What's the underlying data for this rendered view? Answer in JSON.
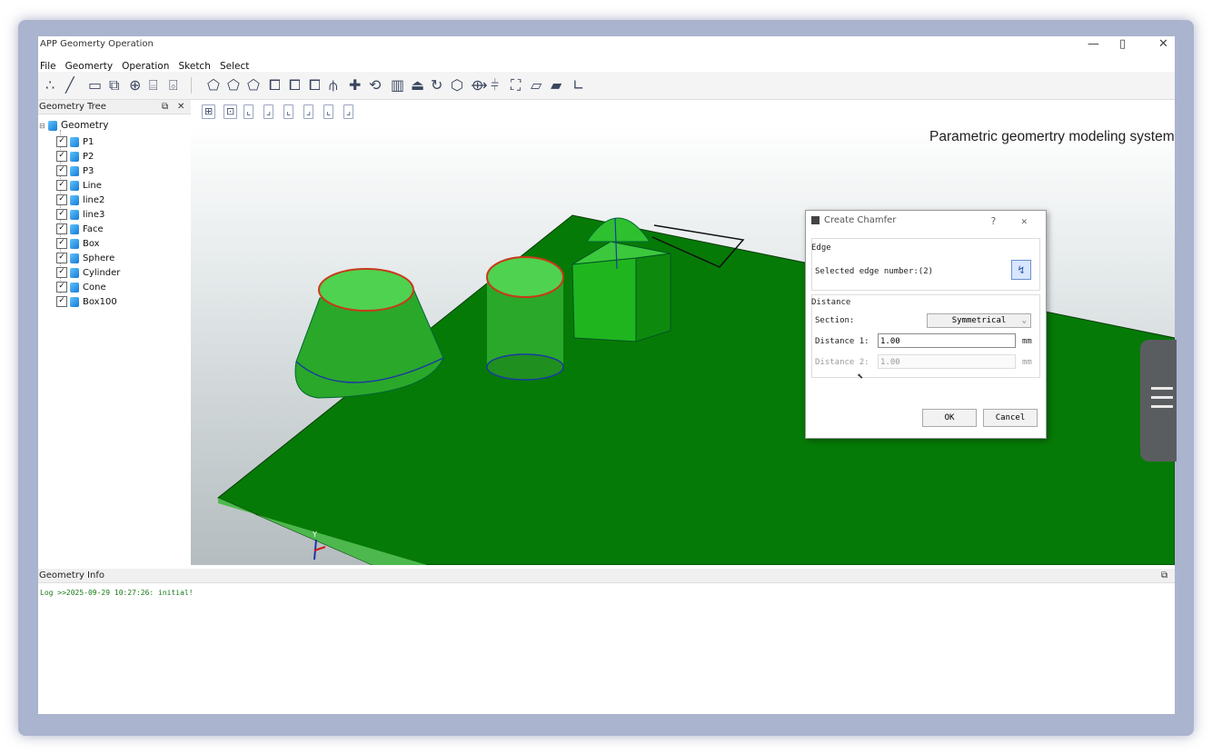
{
  "window": {
    "title": "APP Geomerty Operation",
    "minimize_glyph": "—",
    "restore_glyph": "▯",
    "close_glyph": "✕"
  },
  "menubar": {
    "items": [
      "File",
      "Geomerty",
      "Operation",
      "Sketch",
      "Select"
    ]
  },
  "sidebar": {
    "title": "Geometry Tree",
    "float_glyph": "⧉",
    "close_glyph": "✕",
    "root": "Geometry",
    "items": [
      "P1",
      "P2",
      "P3",
      "Line",
      "line2",
      "line3",
      "Face",
      "Box",
      "Sphere",
      "Cylinder",
      "Cone",
      "Box100"
    ]
  },
  "viewport": {
    "watermark": "Parametric geomertry modeling system"
  },
  "dialog": {
    "title": "Create Chamfer",
    "help_glyph": "?",
    "close_glyph": "✕",
    "edge_group": "Edge",
    "selected_edge_label": "Selected edge number:(2)",
    "distance_group": "Distance",
    "section_label": "Section:",
    "section_value": "Symmetrical",
    "distance1_label": "Distance 1:",
    "distance1_value": "1.00",
    "distance1_unit": "mm",
    "distance2_label": "Distance 2:",
    "distance2_value": "1.00",
    "distance2_unit": "mm",
    "ok_label": "OK",
    "cancel_label": "Cancel"
  },
  "info": {
    "title": "Geometry Info",
    "float_glyph": "⧉",
    "log": "Log >>2025-09-29 10:27:26: initial!"
  },
  "colors": {
    "plane": "#067a06",
    "solid": "#1fb51f",
    "viewport_bottom": "#b4bcbf",
    "log_text": "#1a7a1a"
  }
}
